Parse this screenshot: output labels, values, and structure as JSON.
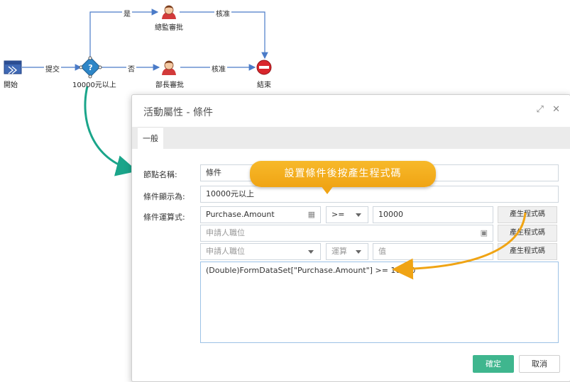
{
  "flow": {
    "start_label": "開始",
    "submit_label": "提交",
    "gateway_label": "10000元以上",
    "yes_label": "是",
    "no_label": "否",
    "gm_label": "總監審批",
    "dept_label": "部長審批",
    "approve_top": "核准",
    "approve_bottom": "核准",
    "end_label": "結束"
  },
  "dialog": {
    "title": "活動屬性 - 條件",
    "tab_general": "一般",
    "node_name_label": "節點名稱:",
    "node_name_value": "條件",
    "display_label": "條件顯示為:",
    "display_value": "10000元以上",
    "expr_label": "條件運算式:",
    "row1": {
      "field": "Purchase.Amount",
      "operator": ">=",
      "value": "10000",
      "button": "產生程式碼"
    },
    "row2": {
      "field_placeholder": "申請人職位",
      "button": "產生程式碼"
    },
    "row3": {
      "field_placeholder": "申請人職位",
      "operator_placeholder": "運算",
      "value_placeholder": "值",
      "button": "產生程式碼"
    },
    "expression": "(Double)FormDataSet[\"Purchase.Amount\"] >= 10000",
    "ok_label": "確定",
    "cancel_label": "取消"
  },
  "callout": {
    "text": "設置條件後按產生程式碼"
  },
  "colors": {
    "flow_line": "#4a7bc8",
    "accent_arrow": "#1aa58a",
    "callout": "#f0a414",
    "ok_button": "#3fb68e"
  }
}
